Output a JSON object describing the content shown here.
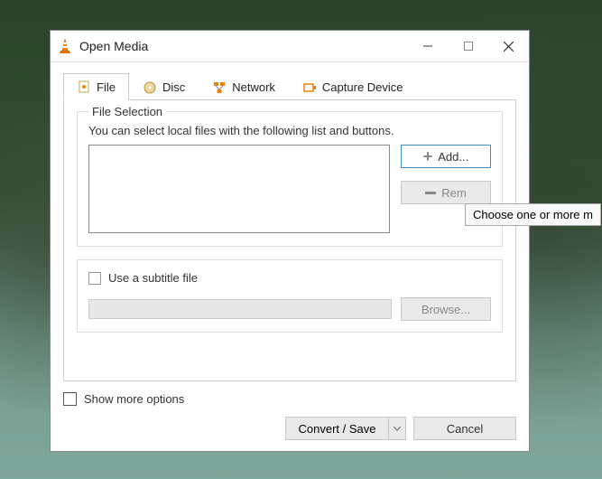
{
  "window": {
    "title": "Open Media"
  },
  "tabs": {
    "file": "File",
    "disc": "Disc",
    "network": "Network",
    "capture": "Capture Device"
  },
  "file_selection": {
    "legend": "File Selection",
    "instruction": "You can select local files with the following list and buttons.",
    "add_label": "Add...",
    "remove_label": "Rem"
  },
  "subtitle": {
    "use_label": "Use a subtitle file",
    "browse_label": "Browse..."
  },
  "footer": {
    "show_more": "Show more options",
    "convert_label": "Convert / Save",
    "cancel_label": "Cancel"
  },
  "tooltip": {
    "text": "Choose one or more m"
  }
}
